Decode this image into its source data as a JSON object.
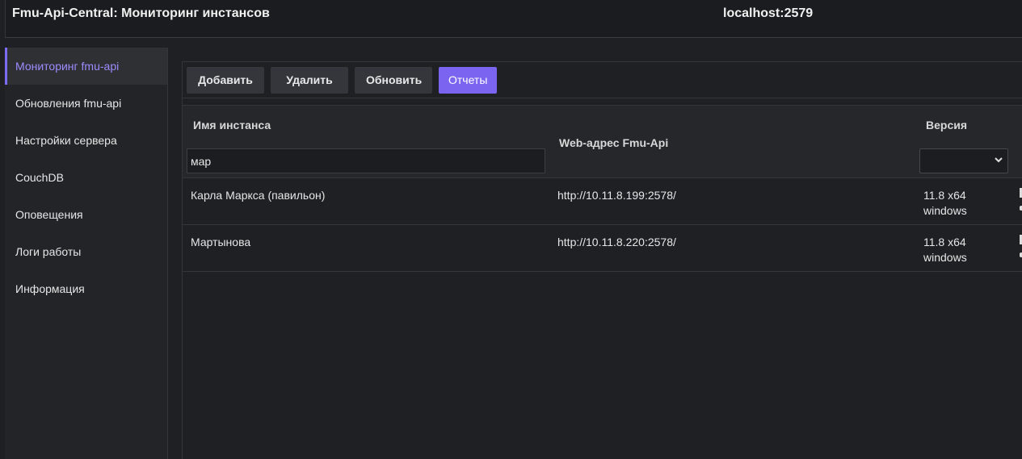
{
  "header": {
    "title_prefix": "Fmu-Api-Central:",
    "title_main": "Мониторинг инстансов",
    "host": "localhost:2579"
  },
  "sidebar": {
    "items": [
      {
        "label": "Мониторинг fmu-api",
        "active": true
      },
      {
        "label": "Обновления fmu-api"
      },
      {
        "label": "Настройки сервера"
      },
      {
        "label": "CouchDB"
      },
      {
        "label": "Оповещения"
      },
      {
        "label": "Логи работы"
      },
      {
        "label": "Информация"
      }
    ]
  },
  "toolbar": {
    "add_label": "Добавить",
    "delete_label": "Удалить",
    "refresh_label": "Обновить",
    "reports_label": "Отчеты"
  },
  "table": {
    "columns": {
      "name": "Имя инстанса",
      "url": "Web-адрес Fmu-Api",
      "version": "Версия"
    },
    "filter": {
      "name_value": "мар",
      "version_value": ""
    },
    "rows": [
      {
        "name": "Карла Маркса (павильон)",
        "url": "http://10.11.8.199:2578/",
        "version_line1": "11.8 x64",
        "version_line2": "windows"
      },
      {
        "name": "Мартынова",
        "url": "http://10.11.8.220:2578/",
        "version_line1": "11.8 x64",
        "version_line2": "windows"
      }
    ]
  },
  "colors": {
    "accent": "#7b64ef",
    "active_nav_text": "#9c8cff",
    "background": "#1f2023"
  }
}
